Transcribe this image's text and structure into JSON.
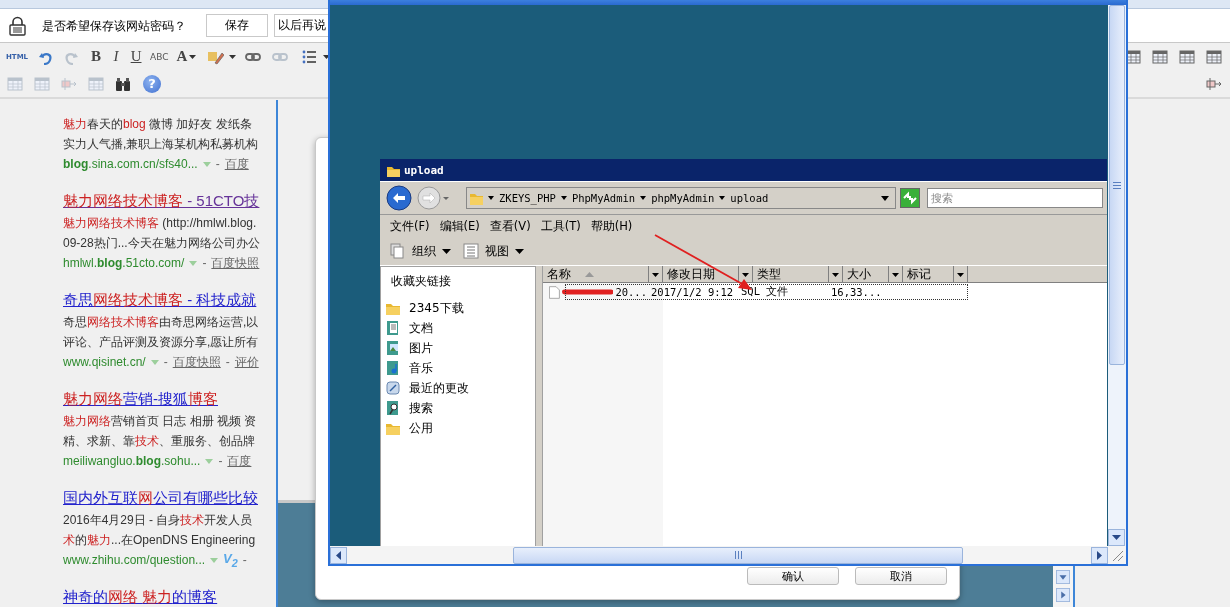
{
  "password_bar": {
    "prompt": "是否希望保存该网站密码？",
    "buttons": [
      "保存",
      "以后再说"
    ]
  },
  "editor_toolbar": {
    "top_row": [
      {
        "kind": "text",
        "label": "HTML"
      },
      {
        "kind": "undo",
        "disabled": false
      },
      {
        "kind": "redo",
        "disabled": true
      },
      {
        "kind": "text",
        "label": "B"
      },
      {
        "kind": "text",
        "label": "I"
      },
      {
        "kind": "text",
        "label": "U"
      },
      {
        "kind": "text",
        "label": "ABC"
      },
      {
        "kind": "text",
        "label": "A",
        "dropdown": true
      },
      {
        "kind": "highlight",
        "dropdown": true
      },
      {
        "kind": "link",
        "disabled": false
      },
      {
        "kind": "link",
        "disabled": true
      },
      {
        "kind": "list",
        "dropdown": true
      }
    ],
    "bottom_row": [
      {
        "kind": "table",
        "disabled": true
      },
      {
        "kind": "table",
        "disabled": true
      },
      {
        "kind": "cells",
        "disabled": true
      },
      {
        "kind": "table",
        "disabled": true
      },
      {
        "kind": "find"
      },
      {
        "kind": "help",
        "label": "?"
      }
    ],
    "top_right": [
      {
        "kind": "table",
        "disabled": false
      },
      {
        "kind": "table",
        "disabled": false
      },
      {
        "kind": "table",
        "disabled": false
      },
      {
        "kind": "table",
        "disabled": false
      }
    ],
    "bottom_right": [
      {
        "kind": "cells",
        "disabled": false
      }
    ]
  },
  "results": [
    {
      "lines": [
        [
          {
            "text": "魅力",
            "highlight": true
          },
          {
            "text": "春天的",
            "highlight": false
          },
          {
            "text": "blog",
            "highlight": true
          },
          {
            "text": " 微博 加好友 发纸条",
            "highlight": false
          }
        ],
        [
          {
            "text": "实力人气播,兼职上海某机构私募机构",
            "highlight": false
          }
        ]
      ],
      "url": [
        {
          "text": "blog",
          "bold": true
        },
        {
          "text": ".sina.com.cn/sfs40...",
          "bold": false
        }
      ],
      "links": [
        {
          "dash": "-",
          "label": "百度"
        }
      ]
    },
    {
      "title": [
        {
          "text": "魅力网络技术博客",
          "highlight": true
        },
        {
          "text": " - 51CTO技",
          "highlight": false
        }
      ],
      "visited": true,
      "lines": [
        [
          {
            "text": "魅力网络技术博客",
            "highlight": true
          },
          {
            "text": " (http://hmlwl.blog.",
            "highlight": false
          }
        ],
        [
          {
            "text": "09-28热门...今天在魅力网络公司办公",
            "highlight": false
          }
        ]
      ],
      "url": [
        {
          "text": "hmlwl.",
          "bold": false
        },
        {
          "text": "blog",
          "bold": true
        },
        {
          "text": ".51cto.com/",
          "bold": false
        }
      ],
      "links": [
        {
          "dash": "-",
          "label": "百度快照"
        }
      ]
    },
    {
      "title": [
        {
          "text": "奇思",
          "highlight": false
        },
        {
          "text": "网络技术博客",
          "highlight": true
        },
        {
          "text": " - 科技成就",
          "highlight": false
        }
      ],
      "visited": false,
      "lines": [
        [
          {
            "text": "奇思",
            "highlight": false
          },
          {
            "text": "网络技术博客",
            "highlight": true
          },
          {
            "text": "由奇思网络运营,以",
            "highlight": false
          }
        ],
        [
          {
            "text": "评论、产品评测及资源分享,愿让所有",
            "highlight": false
          }
        ]
      ],
      "url": [
        {
          "text": "www.qisinet.cn/",
          "bold": false
        }
      ],
      "links": [
        {
          "dash": "-",
          "label": "百度快照"
        },
        {
          "dash": "-",
          "label": "评价"
        }
      ]
    },
    {
      "title": [
        {
          "text": "魅力网络",
          "highlight": true
        },
        {
          "text": "营销-搜狐",
          "highlight": false
        },
        {
          "text": "博客",
          "highlight": true
        }
      ],
      "visited": false,
      "lines": [
        [
          {
            "text": "魅力网络",
            "highlight": true
          },
          {
            "text": "营销首页 日志 相册 视频 资",
            "highlight": false
          }
        ],
        [
          {
            "text": "精、求新、靠",
            "highlight": false
          },
          {
            "text": "技术",
            "highlight": true
          },
          {
            "text": "、重服务、创品牌",
            "highlight": false
          }
        ]
      ],
      "url": [
        {
          "text": "meiliwangluo.",
          "bold": false
        },
        {
          "text": "blog",
          "bold": true
        },
        {
          "text": ".sohu...",
          "bold": false
        }
      ],
      "links": [
        {
          "dash": "-",
          "label": "百度"
        }
      ]
    },
    {
      "title": [
        {
          "text": "国内外互联",
          "highlight": false
        },
        {
          "text": "网",
          "highlight": true
        },
        {
          "text": "公司有哪些比较",
          "highlight": false
        }
      ],
      "visited": false,
      "lines": [
        [
          {
            "text": "2016年4月29日 - 自身",
            "highlight": false
          },
          {
            "text": "技术",
            "highlight": true
          },
          {
            "text": "开发人员",
            "highlight": false
          }
        ],
        [
          {
            "text": "术",
            "highlight": true
          },
          {
            "text": "的",
            "highlight": false
          },
          {
            "text": "魅力",
            "highlight": true
          },
          {
            "text": "...在OpenDNS Engineering",
            "highlight": false
          }
        ]
      ],
      "url": [
        {
          "text": "www.zhihu.com/question...",
          "bold": false
        }
      ],
      "badge": "V$_{2}$",
      "links": [
        {
          "dash": "-"
        }
      ]
    },
    {
      "title": [
        {
          "text": "神奇的",
          "highlight": false
        },
        {
          "text": "网络 ",
          "highlight": true
        },
        {
          "text": "魅力",
          "highlight": true
        },
        {
          "text": "的博客",
          "highlight": false
        }
      ],
      "visited": false
    }
  ],
  "dialog": {
    "buttons": [
      "确认",
      "取消"
    ]
  },
  "explorer": {
    "title": "upload",
    "path": [
      "ZKEYS_PHP",
      "PhpMyAdmin",
      "phpMyAdmin",
      "upload"
    ],
    "search": {
      "placeholder": "搜索"
    },
    "menu": [
      "文件(F)",
      "编辑(E)",
      "查看(V)",
      "工具(T)",
      "帮助(H)"
    ],
    "commands": [
      "组织",
      "视图"
    ],
    "favorites_title": "收藏夹链接",
    "favorites": [
      {
        "label": "2345下载",
        "kind": "folder"
      },
      {
        "label": "文档",
        "kind": "documents"
      },
      {
        "label": "图片",
        "kind": "pictures"
      },
      {
        "label": "音乐",
        "kind": "music"
      },
      {
        "label": "最近的更改",
        "kind": "recent"
      },
      {
        "label": "搜索",
        "kind": "search"
      },
      {
        "label": "公用",
        "kind": "folder"
      }
    ],
    "columns": [
      {
        "label": "名称",
        "sorted": true
      },
      {
        "label": "修改日期",
        "sorted": false
      },
      {
        "label": "类型",
        "sorted": false
      },
      {
        "label": "大小",
        "sorted": false
      },
      {
        "label": "标记",
        "sorted": false
      }
    ],
    "files": [
      {
        "name": "20...",
        "modified": "2017/1/2 9:12",
        "type": "SQL 文件",
        "size": "16,33...",
        "selected": true
      }
    ]
  }
}
